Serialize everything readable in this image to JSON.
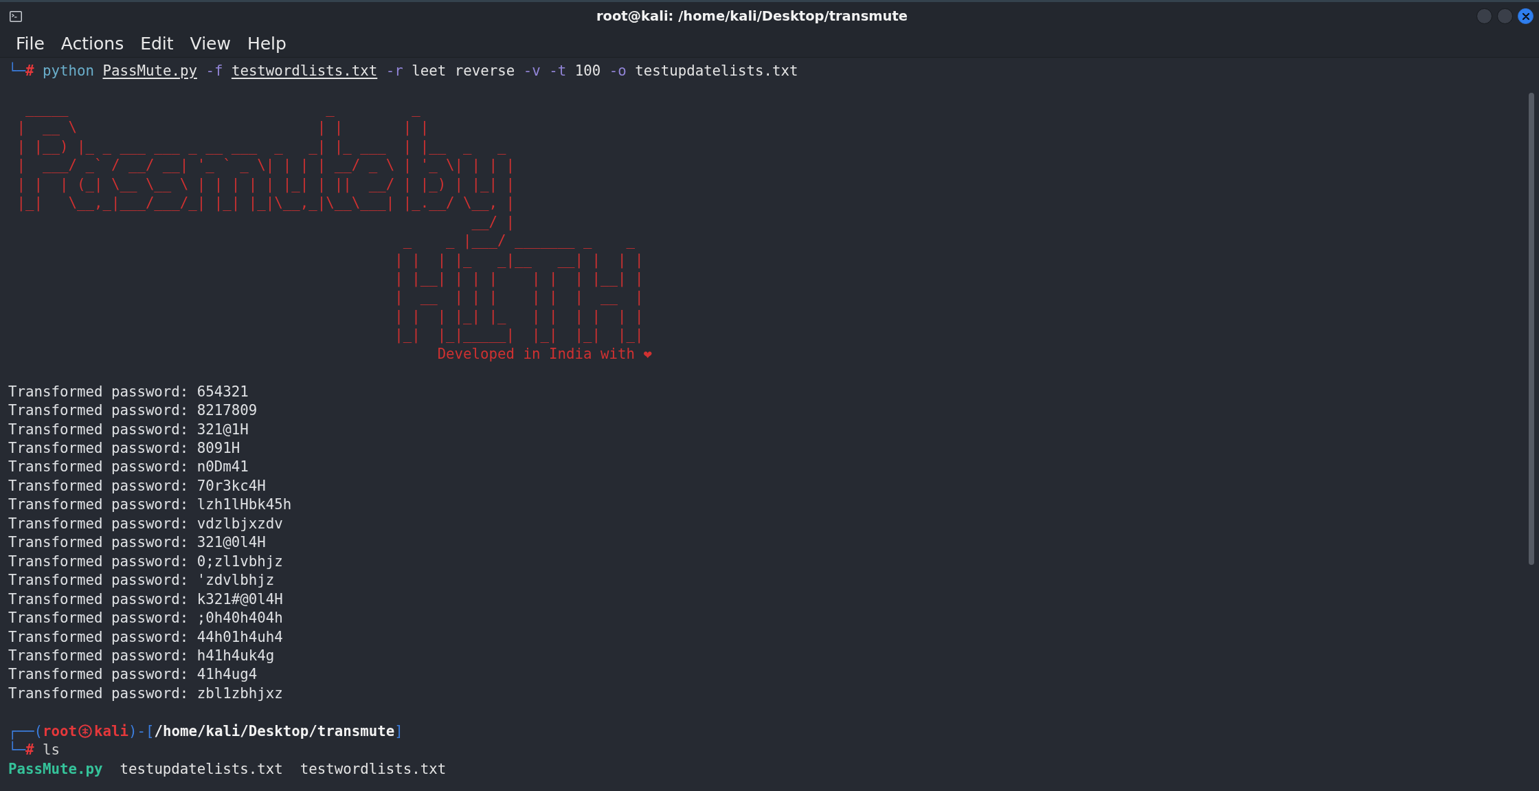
{
  "window": {
    "title": "root@kali: /home/kali/Desktop/transmute"
  },
  "menu": [
    "File",
    "Actions",
    "Edit",
    "View",
    "Help"
  ],
  "terminal": {
    "command": {
      "corner": "└─",
      "mark": "#",
      "tokens": [
        {
          "text": "python",
          "kind": "command"
        },
        {
          "text": "PassMute.py",
          "kind": "path"
        },
        {
          "text": "-f",
          "kind": "option"
        },
        {
          "text": "testwordlists.txt",
          "kind": "path"
        },
        {
          "text": "-r",
          "kind": "option"
        },
        {
          "text": "leet",
          "kind": "arg"
        },
        {
          "text": "reverse",
          "kind": "arg"
        },
        {
          "text": "-v",
          "kind": "option"
        },
        {
          "text": "-t",
          "kind": "option"
        },
        {
          "text": "100",
          "kind": "arg"
        },
        {
          "text": "-o",
          "kind": "option"
        },
        {
          "text": "testupdatelists.txt",
          "kind": "arg"
        }
      ]
    },
    "banner": {
      "lines": [
        "  _____                              _         _",
        " |  __ \\                            | |       | |",
        " | |__) |_ _ ___ ___ _ __ ___  _   _| |_ ___  | |__  _   _",
        " |  ___/ _` / __/ __| '_ ` _ \\| | | | __/ _ \\ | '_ \\| | | |",
        " | |  | (_| \\__ \\__ \\ | | | | | |_| | ||  __/ | |_) | |_| |",
        " |_|   \\__,_|___/___/_| |_| |_|\\__,_|\\__\\___| |_.__/ \\__, |",
        "                                                      __/ |",
        "                                              _    _ |___/ _______ _    _",
        "                                             | |  | |_   _|__   __| |  | |",
        "                                             | |__| | | |    | |  | |__| |",
        "                                             |  __  | | |    | |  |  __  |",
        "                                             | |  | |_| |_   | |  | |  | |",
        "                                             |_|  |_|_____|  |_|  |_|  |_|"
      ],
      "credit": "Developed in India with ❤"
    },
    "output": [
      "Transformed password: 654321",
      "Transformed password: 8217809",
      "Transformed password: 321@1H",
      "Transformed password: 8091H",
      "Transformed password: n0Dm41",
      "Transformed password: 70r3kc4H",
      "Transformed password: lzh1lHbk45h",
      "Transformed password: vdzlbjxzdv",
      "Transformed password: 321@0l4H",
      "Transformed password: 0;zl1vbhjz",
      "Transformed password: 'zdvlbhjz",
      "Transformed password: k321#@0l4H",
      "Transformed password: ;0h40h404h",
      "Transformed password: 44h01h4uh4",
      "Transformed password: h41h4uk4g",
      "Transformed password: 41h4ug4",
      "Transformed password: zbl1zbhjxz"
    ],
    "prompt": {
      "open": "┌──(",
      "user": "root",
      "host": "kali",
      "middle": ")-[",
      "cwd": "/home/kali/Desktop/transmute",
      "close": "]",
      "corner": "└─",
      "mark": "#",
      "command": "ls"
    },
    "listing": [
      {
        "name": "PassMute.py",
        "kind": "executable"
      },
      {
        "name": "testupdatelists.txt",
        "kind": "file"
      },
      {
        "name": "testwordlists.txt",
        "kind": "file"
      }
    ]
  }
}
